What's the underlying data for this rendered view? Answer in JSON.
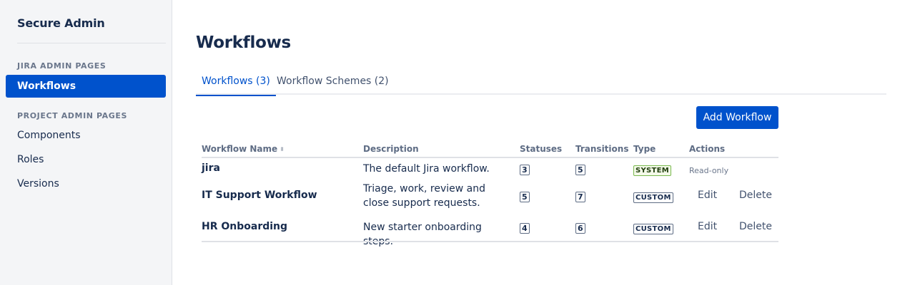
{
  "sidebar": {
    "brand": "Secure Admin",
    "sections": [
      {
        "heading": "JIRA ADMIN PAGES",
        "items": [
          {
            "label": "Workflows",
            "active": true
          }
        ]
      },
      {
        "heading": "PROJECT ADMIN PAGES",
        "items": [
          {
            "label": "Components"
          },
          {
            "label": "Roles"
          },
          {
            "label": "Versions"
          }
        ]
      }
    ]
  },
  "main": {
    "title": "Workflows",
    "tabs": [
      {
        "label": "Workflows (3)",
        "active": true
      },
      {
        "label": "Workflow Schemes (2)",
        "active": false
      }
    ],
    "add_button_label": "Add Workflow"
  },
  "table": {
    "columns": [
      "Workflow Name",
      "Description",
      "Statuses",
      "Transitions",
      "Type",
      "Actions"
    ],
    "rows": [
      {
        "name": "jira",
        "description": "The default Jira workflow.",
        "statuses": "3",
        "transitions": "5",
        "type": "SYSTEM",
        "actions": [
          "Read-only"
        ]
      },
      {
        "name": "IT Support Workflow",
        "description": "Triage, work, review and close support requests.",
        "statuses": "5",
        "transitions": "7",
        "type": "CUSTOM",
        "actions": [
          "Edit",
          "Delete"
        ]
      },
      {
        "name": "HR Onboarding",
        "description": "New starter onboarding steps.",
        "statuses": "4",
        "transitions": "6",
        "type": "CUSTOM",
        "actions": [
          "Edit",
          "Delete"
        ]
      }
    ]
  },
  "colors": {
    "accent": "#0052cc",
    "sidebar_bg": "#f4f5f7",
    "text": "#172b4d",
    "system_lozenge_border": "#79b84e"
  },
  "icons": {
    "sort": "sort-icon"
  }
}
